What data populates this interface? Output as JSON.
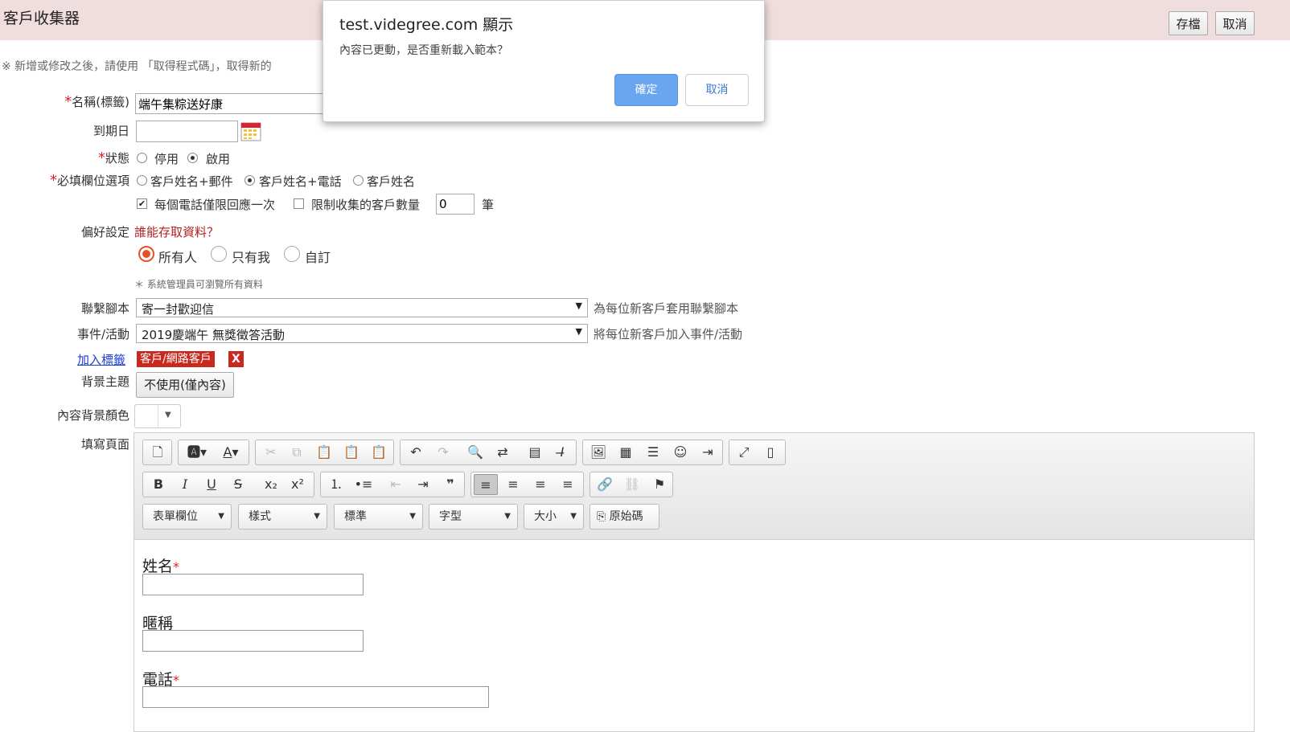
{
  "header": {
    "title": "客戶收集器",
    "save_label": "存檔",
    "cancel_label": "取消"
  },
  "notice": "※ 新增或修改之後，請使用 「取得程式碼」，取得新的",
  "form": {
    "name_label": "名稱(標籤)",
    "name_value": "端午集粽送好康",
    "due_label": "到期日",
    "due_value": "",
    "status_label": "狀態",
    "status_options": [
      "停用",
      "啟用"
    ],
    "required_label": "必填欄位選項",
    "required_options": [
      "客戶姓名+郵件",
      "客戶姓名+電話",
      "客戶姓名"
    ],
    "phone_once_label": "每個電話僅限回應一次",
    "limit_label": "限制收集的客戶數量",
    "limit_value": "0",
    "limit_unit": "筆",
    "pref_label": "偏好設定",
    "pref_link": "誰能存取資料？",
    "access_options": [
      "所有人",
      "只有我",
      "自訂"
    ],
    "admin_note": "＊ 系統管理員可瀏覽所有資料",
    "script_label": "聯繫腳本",
    "script_value": "寄一封歡迎信",
    "script_hint": "為每位新客戶套用聯繫腳本",
    "event_label": "事件/活動",
    "event_value": "2019慶端午 無獎徵答活動",
    "event_hint": "將每位新客戶加入事件/活動",
    "tag_link": "加入標籤",
    "tag_value": "客戶/網路客戶",
    "tag_remove": "X",
    "theme_label": "背景主題",
    "theme_button": "不使用(僅內容)",
    "bgcolor_label": "內容背景顏色",
    "page_label": "填寫頁面"
  },
  "editor": {
    "combos": [
      "表單欄位",
      "樣式",
      "標準",
      "字型",
      "大小"
    ],
    "source_label": "原始碼",
    "fields": [
      {
        "label": "姓名",
        "required": true
      },
      {
        "label": "暱稱",
        "required": false
      },
      {
        "label": "電話",
        "required": true
      }
    ]
  },
  "dialog": {
    "title": "test.videgree.com 顯示",
    "message": "內容已更動，是否重新載入範本？",
    "ok_label": "確定",
    "cancel_label": "取消"
  },
  "colors": {
    "header_bg": "#f0dede",
    "required": "#e02020",
    "tag_bg": "#c8281e",
    "accent_radio": "#e8502a",
    "dialog_ok": "#6aa6f0"
  }
}
